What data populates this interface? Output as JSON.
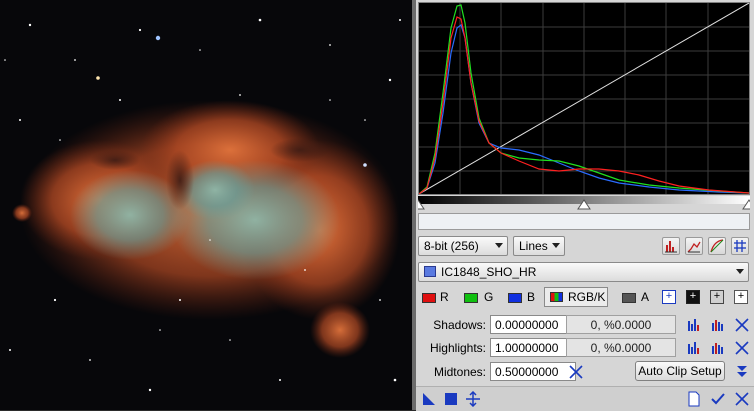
{
  "image": {
    "description_icon": "nebula-image"
  },
  "histogram": {
    "background": "#000000",
    "grid_color": "#3c3c3c",
    "curve_colors": {
      "red": "#ff2020",
      "green": "#20e020",
      "blue": "#2a6cff",
      "identity": "#e0e0e0"
    }
  },
  "controls": {
    "resolution_label": "8-bit (256)",
    "style_label": "Lines",
    "view_target": "IC1848_SHO_HR"
  },
  "channels": [
    {
      "label": "R",
      "color": "#e01010"
    },
    {
      "label": "G",
      "color": "#10c010"
    },
    {
      "label": "B",
      "color": "#1030e0"
    },
    {
      "label": "RGB/K",
      "color": "#888888"
    },
    {
      "label": "A",
      "color": "#555555"
    }
  ],
  "params": {
    "shadows_label": "Shadows:",
    "shadows_value": "0.00000000",
    "shadows_clip": "0, %0.0000",
    "highlights_label": "Highlights:",
    "highlights_value": "1.00000000",
    "highlights_clip": "0, %0.0000",
    "midtones_label": "Midtones:",
    "midtones_value": "0.50000000",
    "auto_clip_label": "Auto Clip Setup"
  },
  "icons": {
    "histogram_view_1": "histogram-log-icon",
    "histogram_view_2": "histogram-cumulative-icon",
    "histogram_view_3": "curve-icon",
    "histogram_view_4": "grid-icon"
  }
}
